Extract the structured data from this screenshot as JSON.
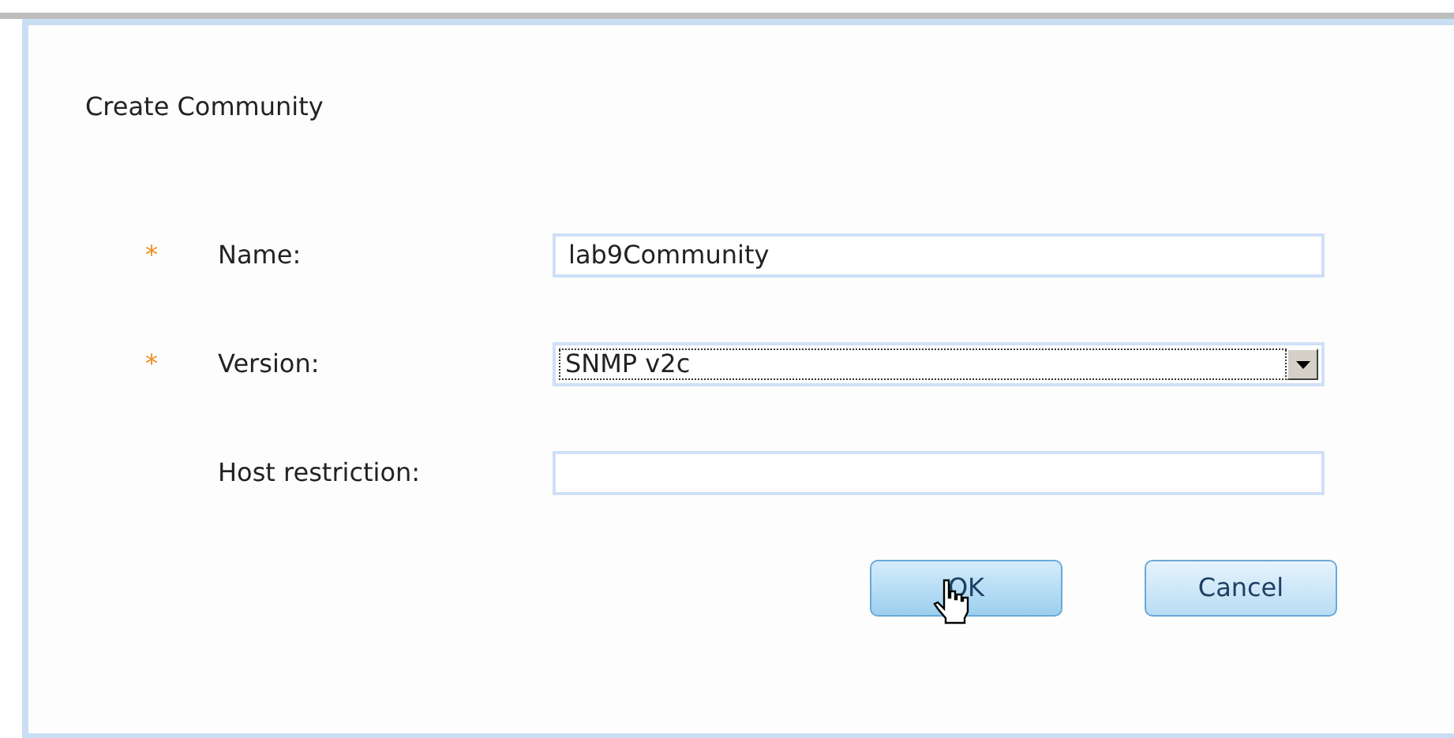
{
  "dialog": {
    "title": "Create Community"
  },
  "fields": [
    {
      "kind": "text",
      "marker": "*",
      "label": "Name:",
      "value": "lab9Community"
    },
    {
      "kind": "select",
      "marker": "*",
      "label": "Version:",
      "value": "SNMP v2c",
      "focused": true
    },
    {
      "kind": "text",
      "label": "Host restriction:"
    }
  ],
  "buttons": [
    {
      "label": "OK",
      "hovered": true
    },
    {
      "label": "Cancel",
      "hovered": false
    }
  ]
}
